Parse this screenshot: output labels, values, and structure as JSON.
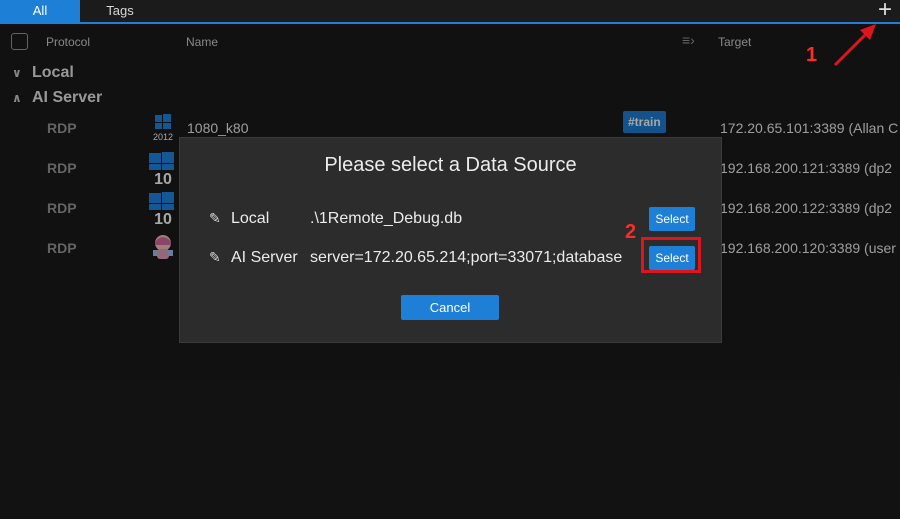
{
  "tabs": {
    "all": "All",
    "tags": "Tags"
  },
  "add_icon": "plus-icon",
  "columns": {
    "protocol": "Protocol",
    "name": "Name",
    "target": "Target"
  },
  "groups": [
    {
      "label": "Local",
      "expanded": false
    },
    {
      "label": "AI Server",
      "expanded": true
    }
  ],
  "rows": [
    {
      "protocol": "RDP",
      "icon": "windows-server-2012-icon",
      "name": "1080_k80",
      "tag": "#train",
      "target": "172.20.65.101:3389 (Allan C"
    },
    {
      "protocol": "RDP",
      "icon": "windows-10-icon",
      "name": "",
      "tag": "",
      "target": "192.168.200.121:3389 (dp2"
    },
    {
      "protocol": "RDP",
      "icon": "windows-10-icon",
      "name": "",
      "tag": "",
      "target": "192.168.200.122:3389 (dp2"
    },
    {
      "protocol": "RDP",
      "icon": "anime-avatar-icon",
      "name": "",
      "tag": "",
      "target": "192.168.200.120:3389 (user"
    }
  ],
  "dialog": {
    "title": "Please select a Data Source",
    "sources": [
      {
        "label": "Local",
        "value": ".\\1Remote_Debug.db",
        "button": "Select"
      },
      {
        "label": "AI Server",
        "value": "server=172.20.65.214;port=33071;database",
        "button": "Select"
      }
    ],
    "cancel": "Cancel"
  },
  "annotations": {
    "step1": "1",
    "step2": "2"
  },
  "colors": {
    "accent": "#1e7fd6",
    "annotation": "#e0141e",
    "background": "#1b1b1b",
    "dialog": "#2c2c2c"
  }
}
